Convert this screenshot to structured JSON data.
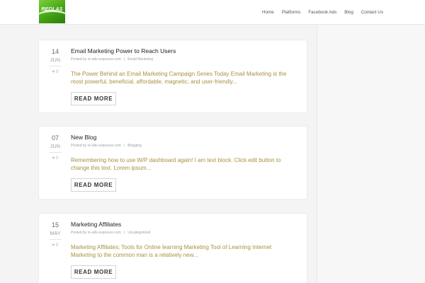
{
  "header": {
    "logo_text": "REOLAS",
    "nav": [
      "Home",
      "Platforms",
      "Facebook Ads",
      "Blog",
      "Contact Us"
    ]
  },
  "posts": [
    {
      "day": "14",
      "month": "JUN",
      "likes": "0",
      "title": "Email Marketing Power to Reach Users",
      "author_line": "Posted by re-ads-exposure.com",
      "category": "Email Marketing",
      "excerpt": "The Power Behind an Email Marketing Campaign Series Today Email Marketing is the most powerful, beneficial, affordable, magnetic, and user-friendly...",
      "button": "READ MORE"
    },
    {
      "day": "07",
      "month": "JUN",
      "likes": "0",
      "title": "New Blog",
      "author_line": "Posted by re-ads-exposure.com",
      "category": "Blogging",
      "excerpt": "Remembering how to use W/P dashboard again! I am text block. Click edit button to change this text. Lorem ipsum...",
      "button": "READ MORE"
    },
    {
      "day": "15",
      "month": "MAY",
      "likes": "0",
      "title": "Marketing Affiliates",
      "author_line": "Posted by re-ads-exposure.com",
      "category": "Uncategorized",
      "excerpt": "Marketing Affiliates; Tools for Online learning Marketing Tool of Learning Internet Marketing to the common man is a relatively new...",
      "button": "READ MORE"
    }
  ],
  "colors": {
    "excerpt": "#a7913f",
    "logo_green": "#4caf1a",
    "background": "#f4f4f4"
  },
  "icons": {
    "likes": "heart-icon"
  }
}
